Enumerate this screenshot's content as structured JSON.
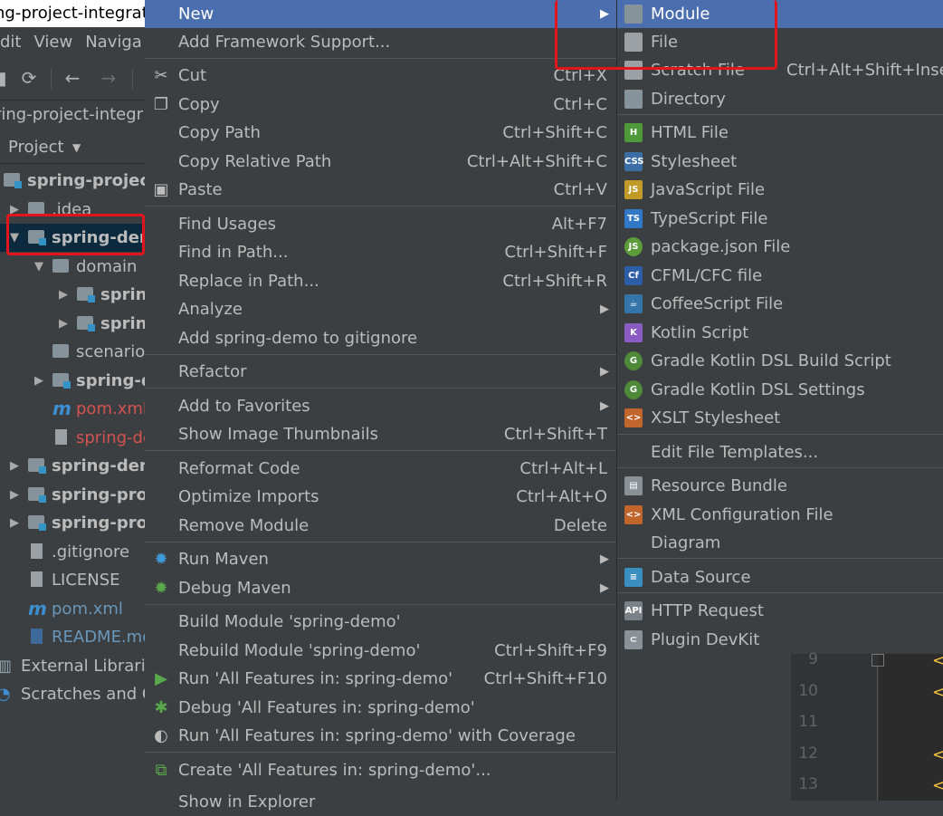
{
  "window_title": "ng-project-integrat",
  "menubar": [
    "dit",
    "View",
    "Naviga"
  ],
  "nav_path": "ring-project-integr",
  "project_header": {
    "label": "Project",
    "dropdown_icon": "caret-down-icon"
  },
  "tree": [
    {
      "label": "spring-project-",
      "indent": 0,
      "type": "module-folder",
      "bold": true
    },
    {
      "label": ".idea",
      "indent": 1,
      "type": "folder"
    },
    {
      "label": "spring-dem",
      "indent": 1,
      "type": "module-folder",
      "bold": true,
      "selected": true
    },
    {
      "label": "domain",
      "indent": 2,
      "type": "folder"
    },
    {
      "label": "spring",
      "indent": 3,
      "type": "module-folder",
      "bold": true
    },
    {
      "label": "spring",
      "indent": 3,
      "type": "module-folder",
      "bold": true
    },
    {
      "label": "scenario",
      "indent": 2,
      "type": "folder"
    },
    {
      "label": "spring-de",
      "indent": 2,
      "type": "module-folder",
      "bold": true
    },
    {
      "label": "pom.xml",
      "indent": 2,
      "type": "maven",
      "color": "red"
    },
    {
      "label": "spring-de",
      "indent": 2,
      "type": "file",
      "color": "red"
    },
    {
      "label": "spring-demo",
      "indent": 1,
      "type": "module-folder",
      "bold": true
    },
    {
      "label": "spring-proje",
      "indent": 1,
      "type": "module-folder",
      "bold": true
    },
    {
      "label": "spring-proje",
      "indent": 1,
      "type": "module-folder",
      "bold": true
    },
    {
      "label": ".gitignore",
      "indent": 1,
      "type": "file"
    },
    {
      "label": "LICENSE",
      "indent": 1,
      "type": "file"
    },
    {
      "label": "pom.xml",
      "indent": 1,
      "type": "maven",
      "color": "blue"
    },
    {
      "label": "README.md",
      "indent": 1,
      "type": "md",
      "color": "blue"
    },
    {
      "label": "External Librarie",
      "indent": 0,
      "type": "libs"
    },
    {
      "label": "Scratches and C",
      "indent": 0,
      "type": "scratch"
    }
  ],
  "context_menu": {
    "new": "New",
    "add_framework": "Add Framework Support...",
    "cut": "Cut",
    "cut_sc": "Ctrl+X",
    "copy": "Copy",
    "copy_sc": "Ctrl+C",
    "copy_path": "Copy Path",
    "copy_path_sc": "Ctrl+Shift+C",
    "copy_rel": "Copy Relative Path",
    "copy_rel_sc": "Ctrl+Alt+Shift+C",
    "paste": "Paste",
    "paste_sc": "Ctrl+V",
    "find_usages": "Find Usages",
    "find_usages_sc": "Alt+F7",
    "find_in_path": "Find in Path...",
    "find_in_path_sc": "Ctrl+Shift+F",
    "replace_in_path": "Replace in Path...",
    "replace_in_path_sc": "Ctrl+Shift+R",
    "analyze": "Analyze",
    "add_gitignore": "Add spring-demo to gitignore",
    "refactor": "Refactor",
    "add_fav": "Add to Favorites",
    "thumbs": "Show Image Thumbnails",
    "thumbs_sc": "Ctrl+Shift+T",
    "reformat": "Reformat Code",
    "reformat_sc": "Ctrl+Alt+L",
    "optimize": "Optimize Imports",
    "optimize_sc": "Ctrl+Alt+O",
    "remove_module": "Remove Module",
    "remove_module_sc": "Delete",
    "run_maven": "Run Maven",
    "debug_maven": "Debug Maven",
    "build_module": "Build Module 'spring-demo'",
    "rebuild_module": "Rebuild Module 'spring-demo'",
    "rebuild_module_sc": "Ctrl+Shift+F9",
    "run_all": "Run 'All Features in: spring-demo'",
    "run_all_sc": "Ctrl+Shift+F10",
    "debug_all": "Debug 'All Features in: spring-demo'",
    "run_cov": "Run 'All Features in: spring-demo' with Coverage",
    "create_all": "Create 'All Features in: spring-demo'...",
    "show_explorer": "Show in Explorer"
  },
  "submenu": [
    {
      "label": "Module",
      "icon": "module-icon",
      "color": "#87939a"
    },
    {
      "label": "File",
      "icon": "file-icon",
      "color": "#9aa0a4"
    },
    {
      "label": "Scratch File",
      "shortcut": "Ctrl+Alt+Shift+Insert",
      "icon": "scratch-file-icon",
      "color": "#9aa0a4"
    },
    {
      "label": "Directory",
      "icon": "directory-icon",
      "color": "#87939a"
    },
    {
      "label": "HTML File",
      "icon": "html-icon",
      "color": "#4e9a3b",
      "tag": "H"
    },
    {
      "label": "Stylesheet",
      "icon": "css-icon",
      "color": "#3a6ea5",
      "tag": "CSS"
    },
    {
      "label": "JavaScript File",
      "icon": "javascript-icon",
      "color": "#c19a27",
      "tag": "JS"
    },
    {
      "label": "TypeScript File",
      "icon": "typescript-icon",
      "color": "#3178c6",
      "tag": "TS"
    },
    {
      "label": "package.json File",
      "icon": "nodejs-icon",
      "color": "#5c9c3a",
      "tag": "JS"
    },
    {
      "label": "CFML/CFC file",
      "icon": "cfml-icon",
      "color": "#2b5ea5",
      "tag": "Cf"
    },
    {
      "label": "CoffeeScript File",
      "icon": "coffeescript-icon",
      "color": "#3574a8",
      "tag": "☕"
    },
    {
      "label": "Kotlin Script",
      "icon": "kotlin-icon",
      "color": "#8a5cc2",
      "tag": "K"
    },
    {
      "label": "Gradle Kotlin DSL Build Script",
      "icon": "gradle-icon",
      "color": "#4f8a3a",
      "tag": "G"
    },
    {
      "label": "Gradle Kotlin DSL Settings",
      "icon": "gradle-icon",
      "color": "#4f8a3a",
      "tag": "G"
    },
    {
      "label": "XSLT Stylesheet",
      "icon": "xslt-icon",
      "color": "#c0652b",
      "tag": "<>"
    },
    {
      "label": "Edit File Templates...",
      "icon": "",
      "color": ""
    },
    {
      "label": "Resource Bundle",
      "icon": "resource-bundle-icon",
      "color": "#8a9298",
      "tag": "▤"
    },
    {
      "label": "XML Configuration File",
      "icon": "xml-icon",
      "color": "#c0652b",
      "tag": "<>"
    },
    {
      "label": "Diagram",
      "icon": "",
      "color": ""
    },
    {
      "label": "Data Source",
      "icon": "database-icon",
      "color": "#3a8ec0",
      "tag": "≡"
    },
    {
      "label": "HTTP Request",
      "icon": "api-icon",
      "color": "#7a8288",
      "tag": "API"
    },
    {
      "label": "Plugin DevKit",
      "icon": "plugin-icon",
      "color": "#8a9298",
      "tag": "⊂"
    }
  ],
  "editor_lines": [
    "9",
    "10",
    "11",
    "12",
    "13"
  ]
}
